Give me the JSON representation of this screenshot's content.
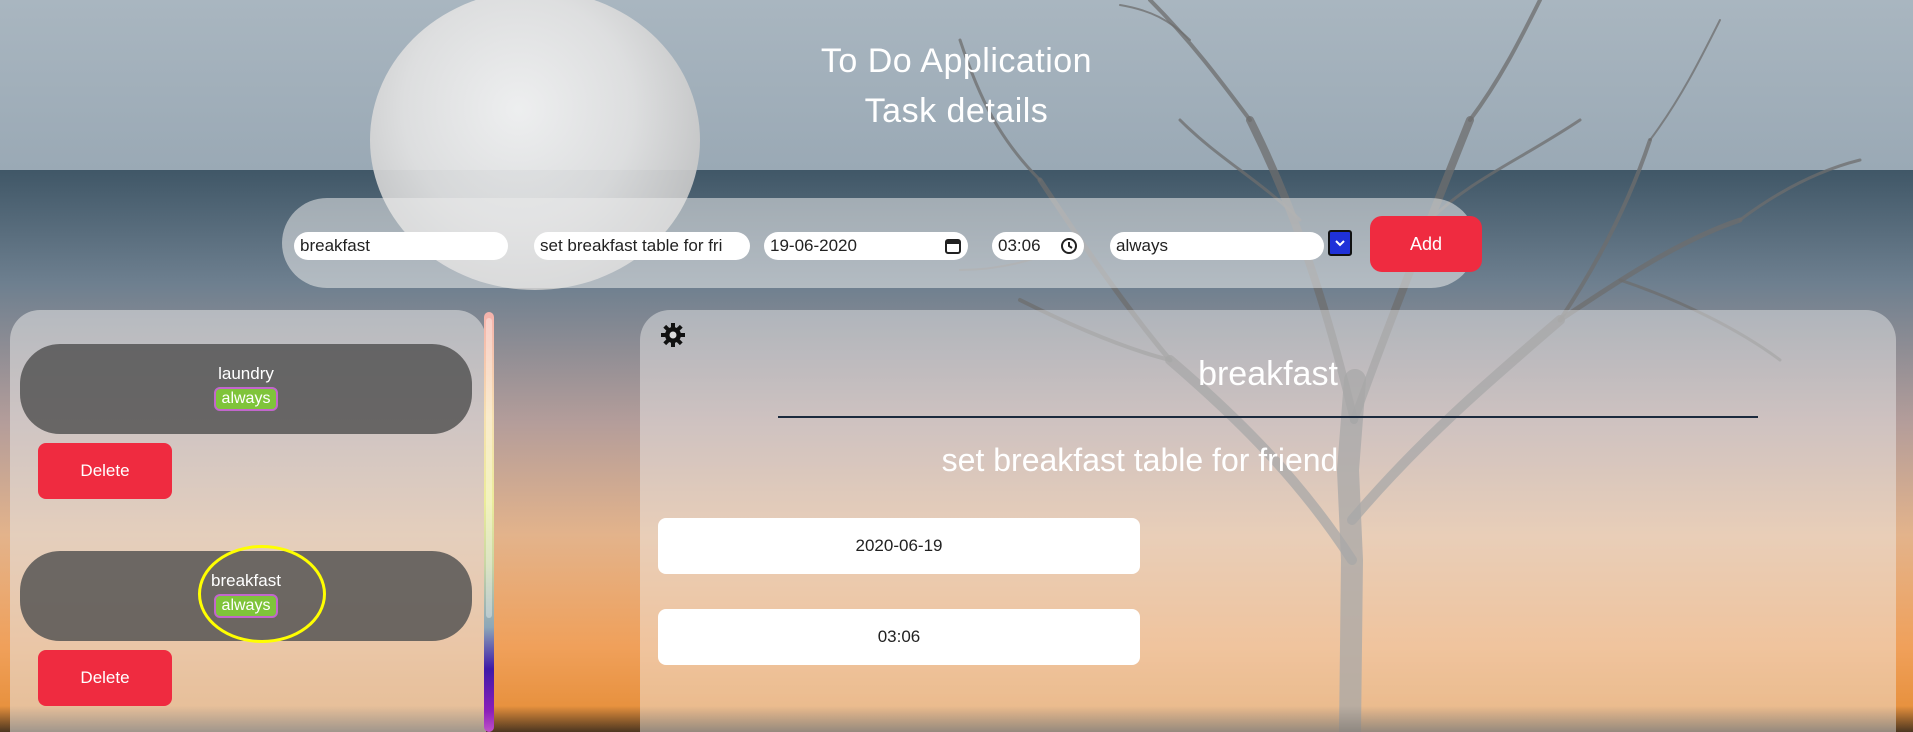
{
  "header": {
    "line1": "To Do Application",
    "line2": "Task details"
  },
  "form": {
    "name_value": "breakfast",
    "description_value": "set breakfast table for fri",
    "date_value": "19-06-2020",
    "time_value": "03:06",
    "frequency_value": "always",
    "add_label": "Add"
  },
  "tasks": [
    {
      "title": "laundry",
      "badge": "always",
      "delete_label": "Delete"
    },
    {
      "title": "breakfast",
      "badge": "always",
      "delete_label": "Delete"
    }
  ],
  "detail": {
    "title": "breakfast",
    "description": "set breakfast table for friend",
    "date": "2020-06-19",
    "time": "03:06"
  },
  "colors": {
    "accent_red": "#ef2b40",
    "badge_green": "#7fc43a",
    "badge_border": "#c266cc",
    "highlight_yellow": "#ffff00"
  }
}
